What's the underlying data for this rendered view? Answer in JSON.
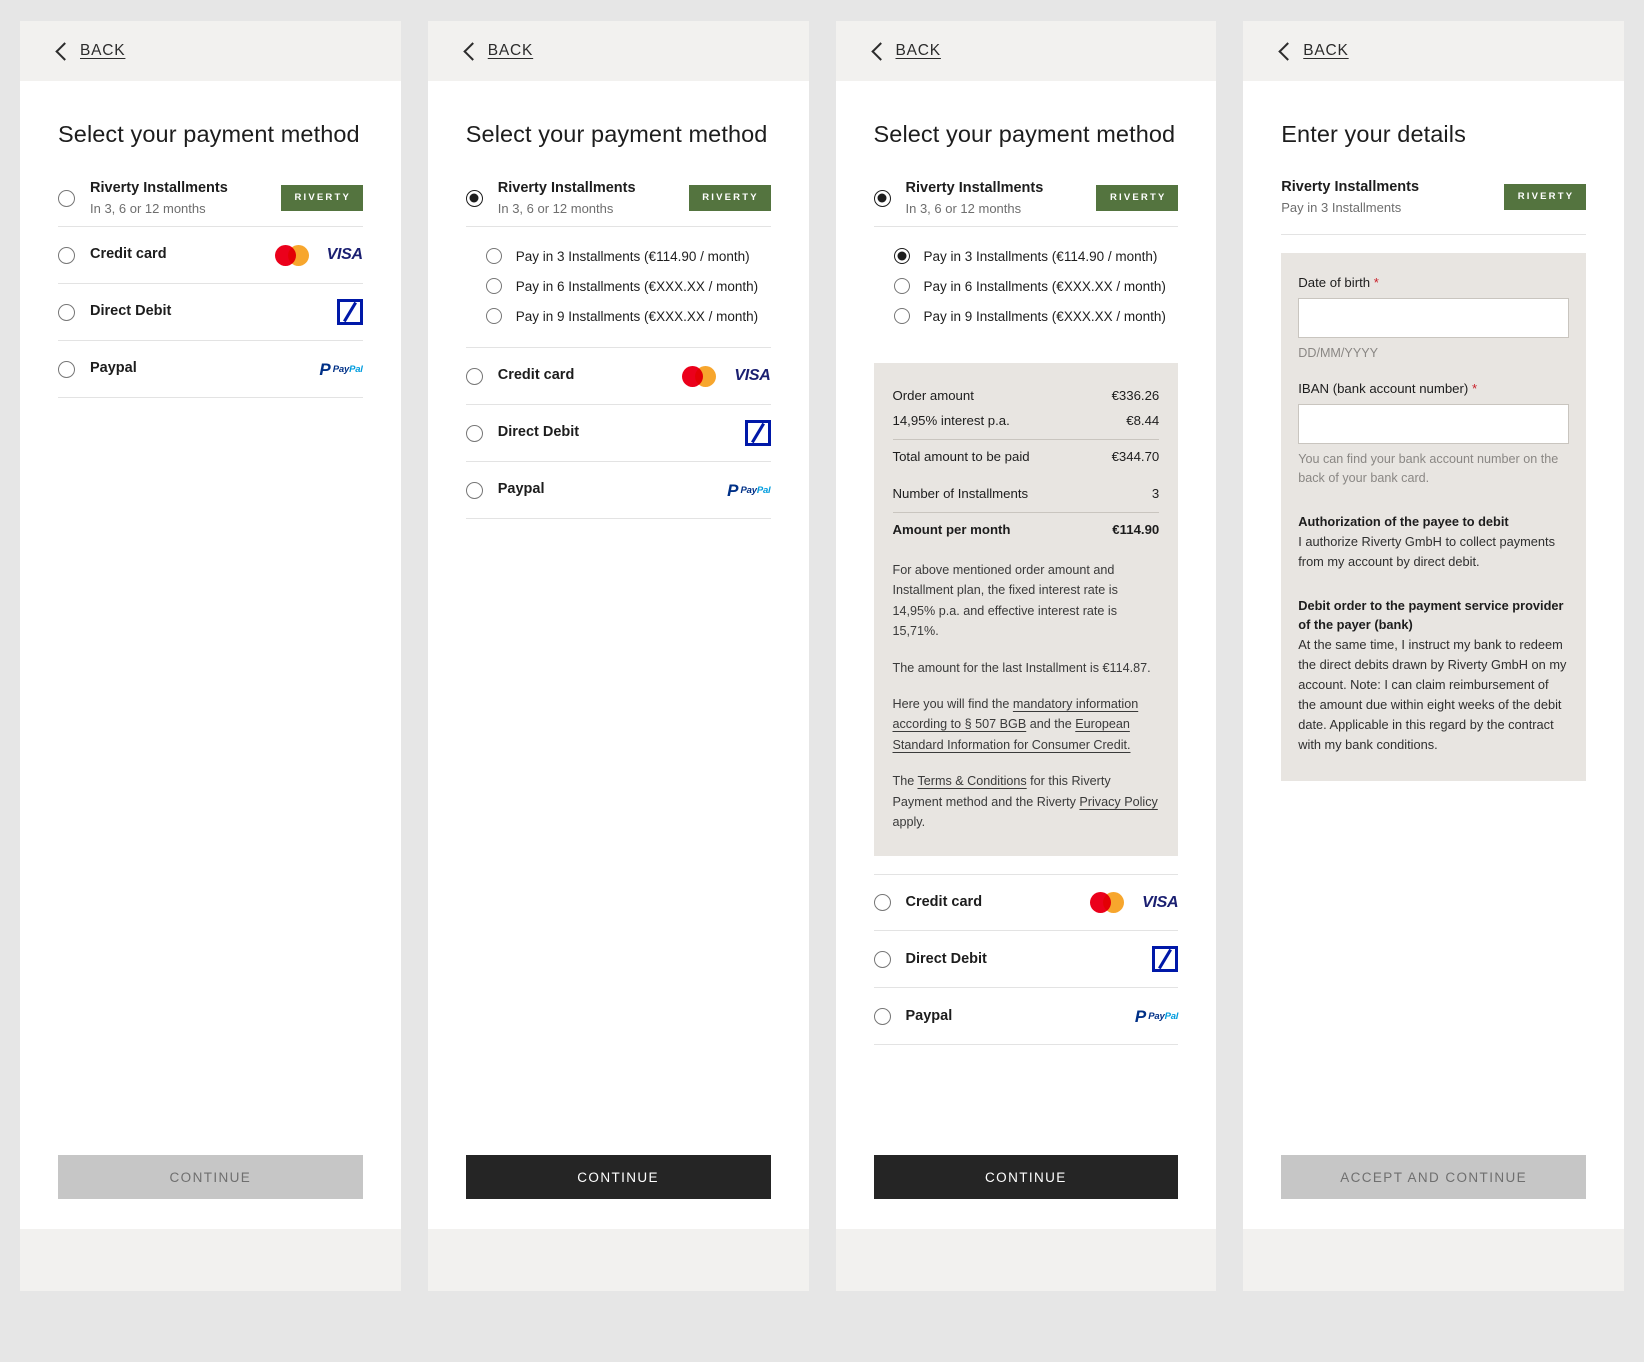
{
  "back_label": "BACK",
  "titles": {
    "select": "Select your payment method",
    "details": "Enter your details"
  },
  "methods": {
    "riverty": {
      "title": "Riverty Installments",
      "sub": "In 3, 6 or 12 months",
      "logo": "RIVERTY"
    },
    "credit": {
      "title": "Credit card"
    },
    "debit": {
      "title": "Direct Debit"
    },
    "paypal": {
      "title": "Paypal"
    }
  },
  "installments": [
    {
      "label": "Pay in 3 Installments (€114.90 / month)"
    },
    {
      "label": "Pay in 6 Installments (€XXX.XX / month)"
    },
    {
      "label": "Pay in 9 Installments (€XXX.XX / month)"
    }
  ],
  "summary": {
    "rows": [
      {
        "label": "Order amount",
        "value": "€336.26"
      },
      {
        "label": "14,95% interest p.a.",
        "value": "€8.44"
      },
      {
        "label": "Total amount to be paid",
        "value": "€344.70"
      },
      {
        "label": "Number of Installments",
        "value": "3"
      },
      {
        "label": "Amount per month",
        "value": "€114.90"
      }
    ],
    "note1": "For above mentioned order amount and Installment plan, the fixed interest rate is 14,95% p.a. and effective interest rate is 15,71%.",
    "note2": "The amount for the last Installment is €114.87.",
    "note3_pre": "Here you will find the ",
    "note3_link1": "mandatory information according to § 507 BGB",
    "note3_mid": " and the ",
    "note3_link2": "European Standard Information for Consumer Credit.",
    "note4_pre": "The ",
    "note4_link1": "Terms & Conditions",
    "note4_mid": " for this Riverty Payment method and the Riverty ",
    "note4_link2": "Privacy Policy",
    "note4_post": " apply."
  },
  "details": {
    "method_title": "Riverty Installments",
    "method_sub": "Pay in 3 Installments",
    "dob_label": "Date of birth",
    "dob_value": "",
    "dob_hint": "DD/MM/YYYY",
    "iban_label": "IBAN (bank account number)",
    "iban_value": "",
    "iban_hint": "You can find your bank account number on the back of your bank card.",
    "auth_head": "Authorization of the payee to debit",
    "auth_body": "I authorize Riverty GmbH to collect payments from my account by direct debit.",
    "debit_head": "Debit order to the payment service provider of the payer (bank)",
    "debit_body": "At the same time, I instruct my bank to redeem the direct debits drawn by Riverty GmbH on my account. Note: I can claim reimbursement of the amount due within eight weeks of the debit date. Applicable in this regard by the contract with my bank conditions.",
    "required_mark": "*"
  },
  "cta": {
    "continue": "CONTINUE",
    "accept_continue": "ACCEPT AND CONTINUE"
  },
  "logos": {
    "visa": "VISA",
    "paypal_mark": "P",
    "paypal_a": "Pay",
    "paypal_b": "Pal"
  },
  "colors": {
    "riverty_green": "#54743f",
    "mastercard_red": "#eb001b",
    "mastercard_orange": "#f79e1b",
    "visa_blue": "#1a1f71",
    "deutsche_bank_blue": "#0018a8",
    "paypal_dark": "#003087",
    "paypal_light": "#009cde",
    "cta_enabled": "#252525",
    "cta_disabled": "#c6c6c6",
    "required_red": "#c9202a",
    "card_bg": "#e8e5e1",
    "page_bg": "#e6e6e6"
  }
}
